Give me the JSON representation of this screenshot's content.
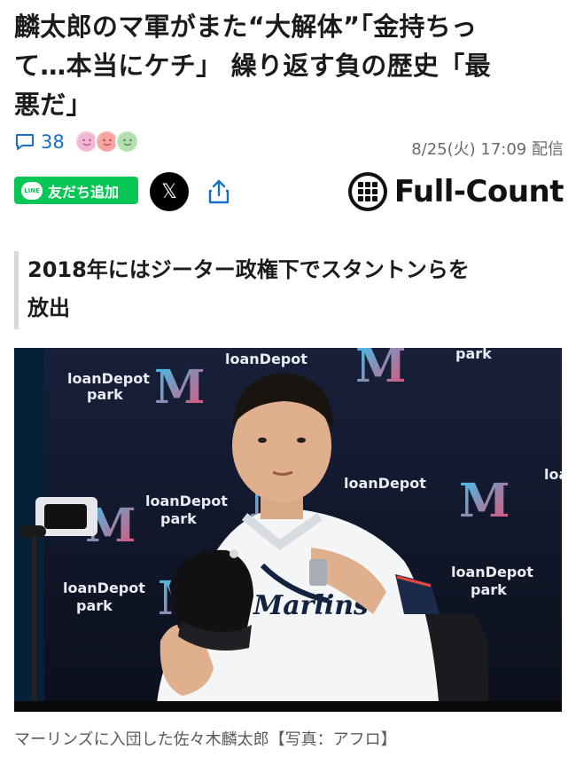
{
  "article": {
    "headline_lines": [
      "麟太郎のマ軍がまた“大解体”「金持ちっ",
      "て…本当にケチ」 繰り返す負の歴史「最",
      "悪だ」"
    ],
    "comment_count": "38",
    "date": "8/25(火) 17:09 配信",
    "subheadline_lines": [
      "2018年にはジーター政権下でスタントンらを",
      "放出"
    ],
    "photo_caption": "マーリンズに入団した佐々木麟太郎【写真：アフロ】"
  },
  "share": {
    "line_label": "友だち追加",
    "line_logo_text": "LINE",
    "x_label": "𝕏"
  },
  "brand": {
    "name": "Full-Count"
  },
  "photo_backdrop": {
    "sponsor_text": "loanDepot",
    "sponsor_sub": "park",
    "team_letter": "M"
  },
  "photo_subject": {
    "jersey_text": "Marlins"
  },
  "icons": {
    "comment": "comment-bubble-icon",
    "share": "share-upload-icon",
    "reactions": [
      "smile-face-pink",
      "smile-face-red",
      "smile-face-green"
    ]
  },
  "colors": {
    "line_green": "#06c755",
    "comment_blue": "#1a6fc2",
    "backdrop_navy": "#0f1424"
  }
}
